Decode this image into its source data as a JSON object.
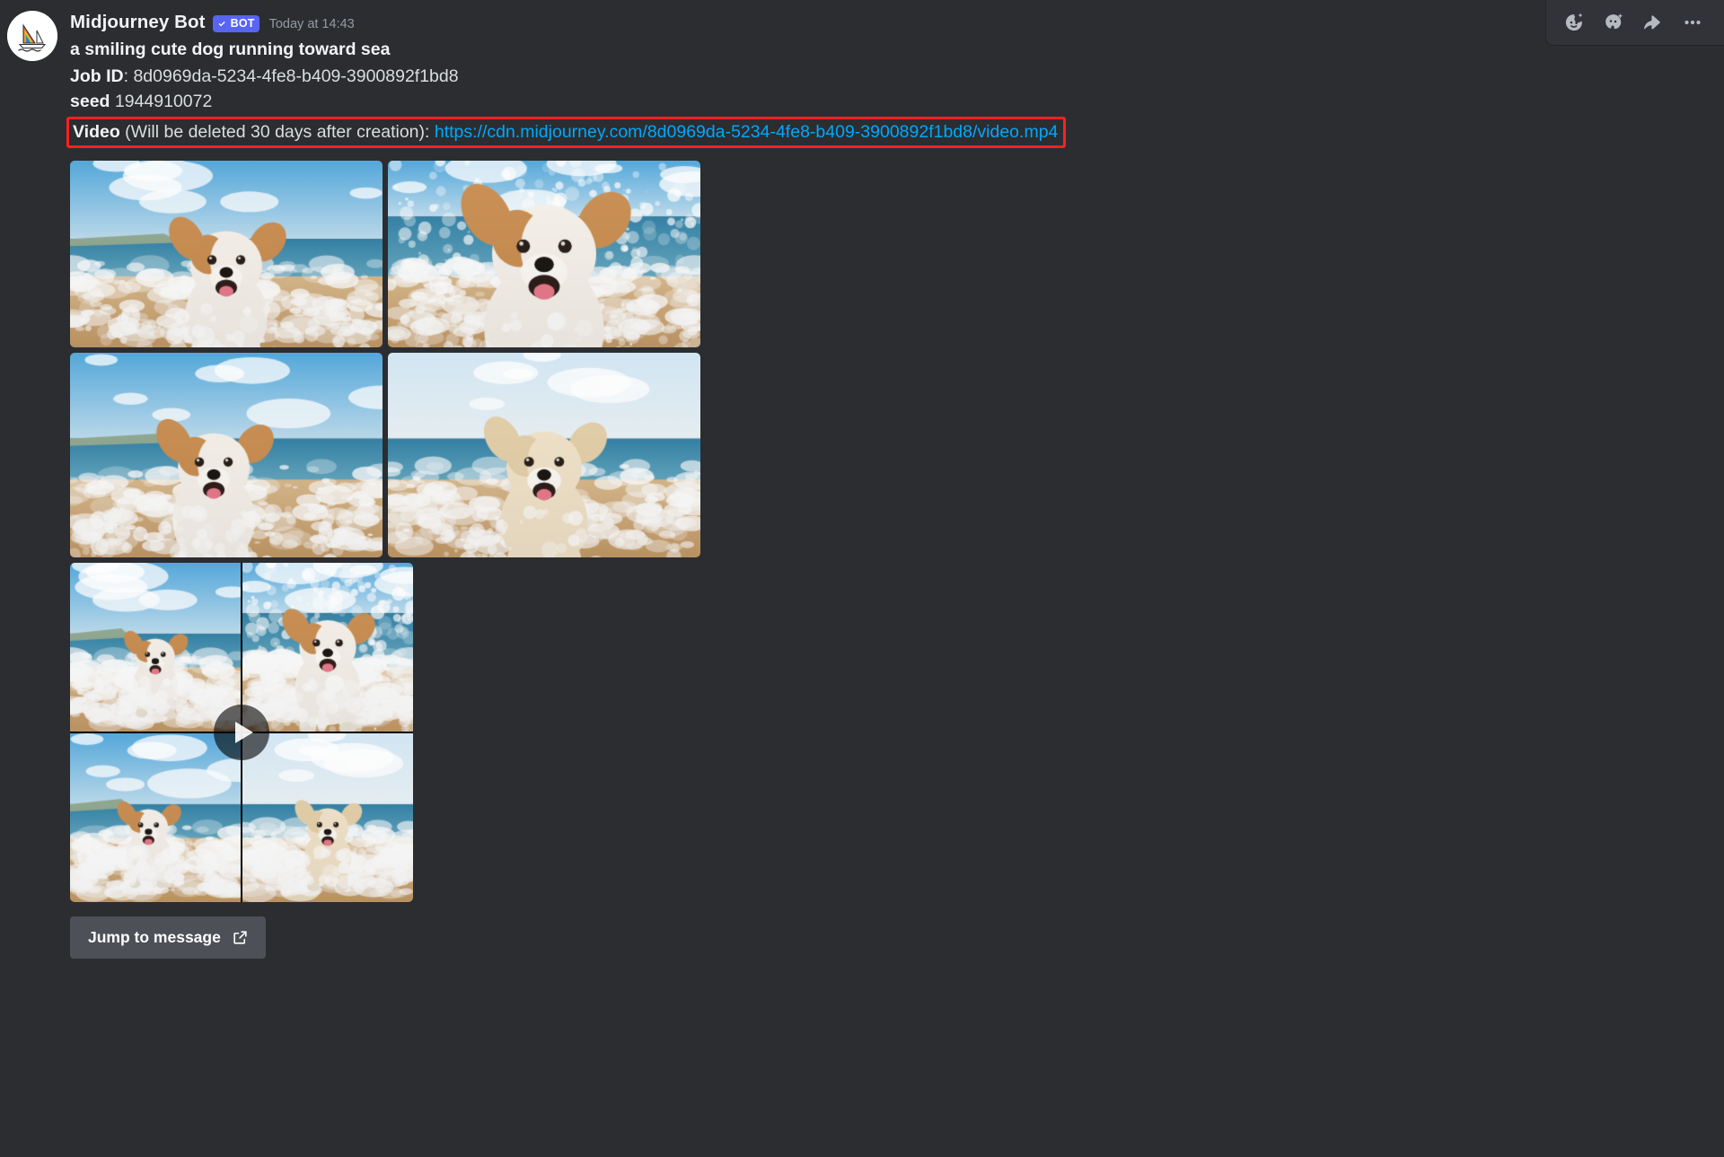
{
  "theme": {
    "background": "#2b2d31",
    "toolbar_bg": "#313338",
    "text": "#dbdee1",
    "text_strong": "#f2f3f5",
    "muted": "#949ba4",
    "link": "#00a8fc",
    "bot_badge_bg": "#5865f2",
    "highlight_border": "#ff2020",
    "button_bg": "#4e5058"
  },
  "message": {
    "author": "Midjourney Bot",
    "bot_badge": "BOT",
    "timestamp": "Today at 14:43",
    "prompt": "a smiling cute dog running toward sea",
    "job_id_label": "Job ID",
    "job_id_sep": ": ",
    "job_id_value": "8d0969da-5234-4fe8-b409-3900892f1bd8",
    "seed_label": "seed",
    "seed_value": "1944910072",
    "video_label": "Video",
    "video_note": " (Will be deleted 30 days after creation): ",
    "video_url": "https://cdn.midjourney.com/8d0969da-5234-4fe8-b409-3900892f1bd8/video.mp4"
  },
  "toolbar": {
    "add_reaction": "add-reaction",
    "add_super_reaction": "add-super-reaction",
    "reply": "reply",
    "more": "more-options"
  },
  "avatar": {
    "alt": "midjourney-sailboat-logo"
  },
  "grid": {
    "images": [
      {
        "alt": "dog-running-on-beach-toward-camera"
      },
      {
        "alt": "wet-dog-splashing-through-wave"
      },
      {
        "alt": "corgi-like-dog-running-in-surf"
      },
      {
        "alt": "fluffy-cream-puppy-running-in-foam"
      }
    ]
  },
  "video": {
    "alt": "video-preview-four-dog-clips",
    "play_button": "play"
  },
  "actions": {
    "jump_label": "Jump to message",
    "jump_icon": "external-link-icon"
  }
}
